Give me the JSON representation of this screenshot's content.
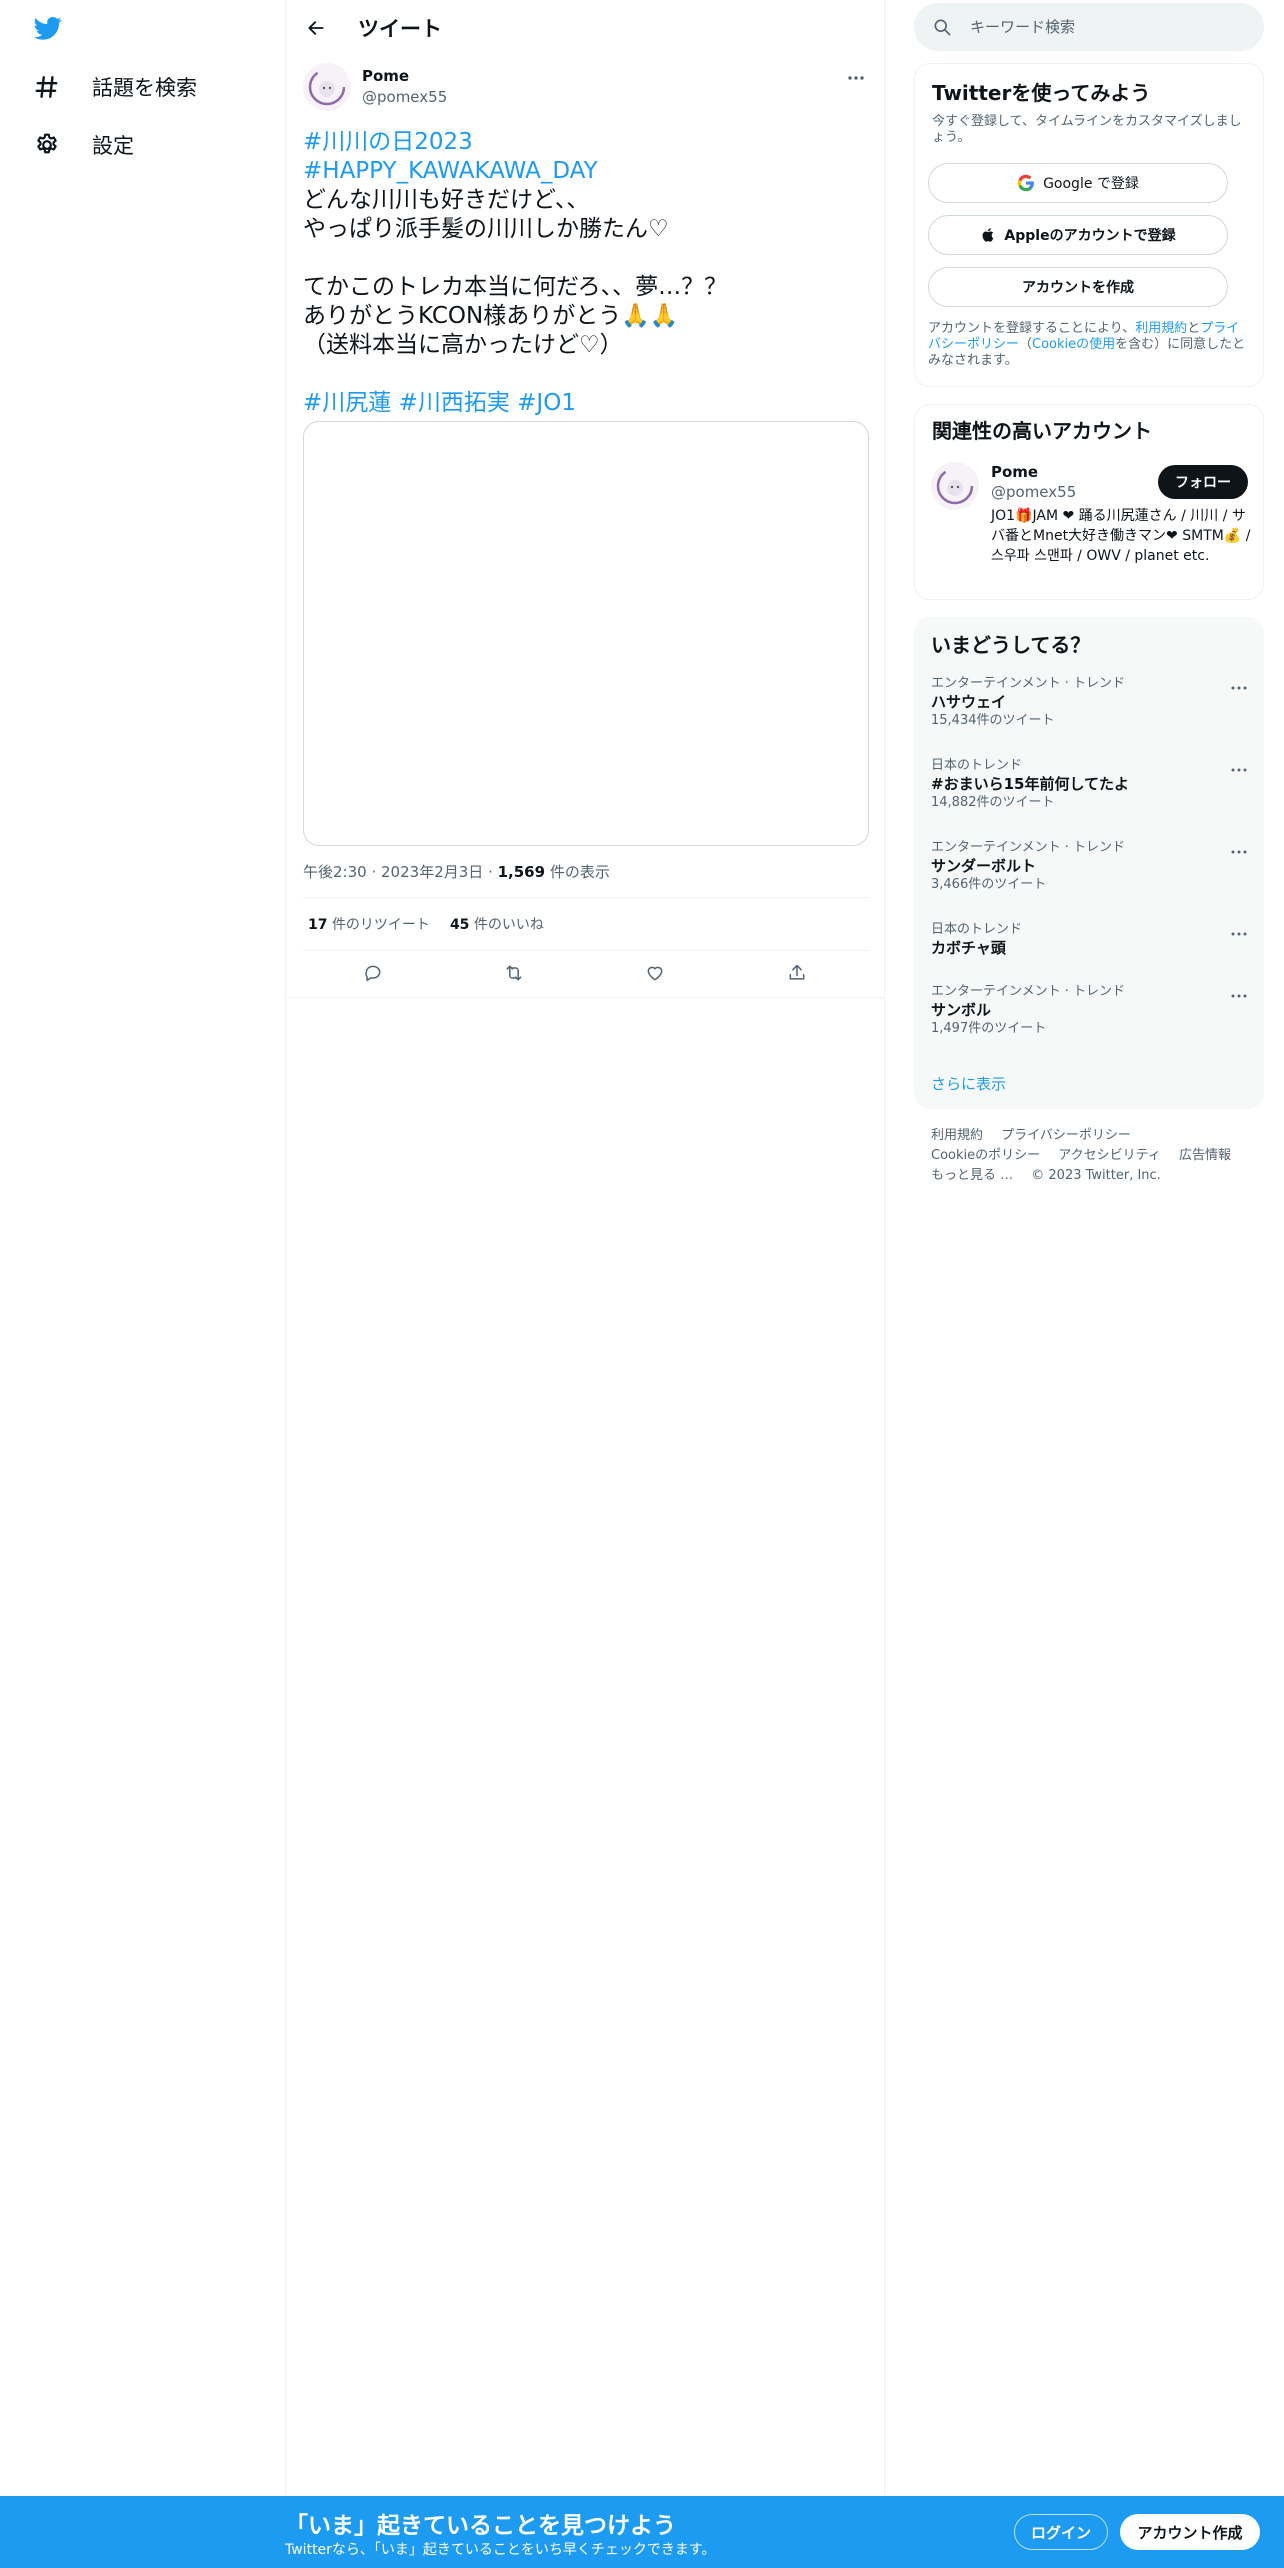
{
  "nav": {
    "logo_icon": "twitter-bird-icon",
    "items": [
      {
        "label": "話題を検索",
        "icon": "hashtag-icon"
      },
      {
        "label": "設定",
        "icon": "gear-icon"
      }
    ]
  },
  "header": {
    "back_icon": "arrow-left-icon",
    "title": "ツイート"
  },
  "tweet": {
    "author_name": "Pome",
    "author_handle": "@pomex55",
    "more_icon": "ellipsis-icon",
    "lines": [
      "#川川の日2023",
      "#HAPPY_KAWAKAWA_DAY",
      "どんな川川も好きだけど、、",
      "やっぱり派手髪の川川しか勝たん♡",
      "",
      "てかこのトレカ本当に何だろ、、夢…？？",
      "ありがとうKCON様ありがとう🙏🙏",
      "（送料本当に高かったけど♡）",
      "",
      "#川尻蓮 #川西拓実 #JO1"
    ],
    "time": "午後2:30",
    "date": "2023年2月3日",
    "views_count": "1,569",
    "views_label": "件の表示",
    "retweets_count": "17",
    "retweets_label": "件のリツイート",
    "likes_count": "45",
    "likes_label": "件のいいね",
    "actions": [
      "reply-icon",
      "retweet-icon",
      "like-icon",
      "share-icon"
    ]
  },
  "search": {
    "placeholder": "キーワード検索"
  },
  "signup_card": {
    "title": "Twitterを使ってみよう",
    "subtitle": "今すぐ登録して、タイムラインをカスタマイズしましょう。",
    "google_button": "Google で登録",
    "apple_button": "Appleのアカウントで登録",
    "create_button": "アカウントを作成",
    "legal_prefix": "アカウントを登録することにより、",
    "legal_terms": "利用規約",
    "legal_and": "と",
    "legal_privacy": "プライバシーポリシー",
    "legal_open": "（",
    "legal_cookie": "Cookieの使用",
    "legal_suffix": "を含む）に同意したとみなされます。"
  },
  "related": {
    "title": "関連性の高いアカウント",
    "name": "Pome",
    "handle": "@pomex55",
    "follow_label": "フォロー",
    "bio": "JO1🎁JAM ❤ 踊る川尻蓮さん / 川川 / サバ番とMnet大好き働きマン❤ SMTM💰 / 스우파 스맨파 / OWV / planet etc."
  },
  "trends": {
    "title": "いまどうしてる？",
    "items": [
      {
        "category": "エンターテインメント · トレンド",
        "name": "ハサウェイ",
        "count": "15,434件のツイート"
      },
      {
        "category": "日本のトレンド",
        "name": "#おまいら15年前何してたよ",
        "count": "14,882件のツイート"
      },
      {
        "category": "エンターテインメント · トレンド",
        "name": "サンダーボルト",
        "count": "3,466件のツイート"
      },
      {
        "category": "日本のトレンド",
        "name": "カボチャ頭",
        "count": ""
      },
      {
        "category": "エンターテインメント · トレンド",
        "name": "サンボル",
        "count": "1,497件のツイート"
      }
    ],
    "show_more": "さらに表示"
  },
  "footer": {
    "links": [
      "利用規約",
      "プライバシーポリシー",
      "Cookieのポリシー",
      "アクセシビリティ",
      "広告情報",
      "もっと見る …",
      "© 2023 Twitter, Inc."
    ]
  },
  "banner": {
    "title": "「いま」起きていることを見つけよう",
    "subtitle": "Twitterなら、「いま」起きていることをいち早くチェックできます。",
    "login_label": "ログイン",
    "signup_label": "アカウント作成"
  },
  "colors": {
    "accent": "#1d9bf0",
    "text": "#0f1419",
    "secondary": "#536471",
    "border": "#eff3f4"
  }
}
